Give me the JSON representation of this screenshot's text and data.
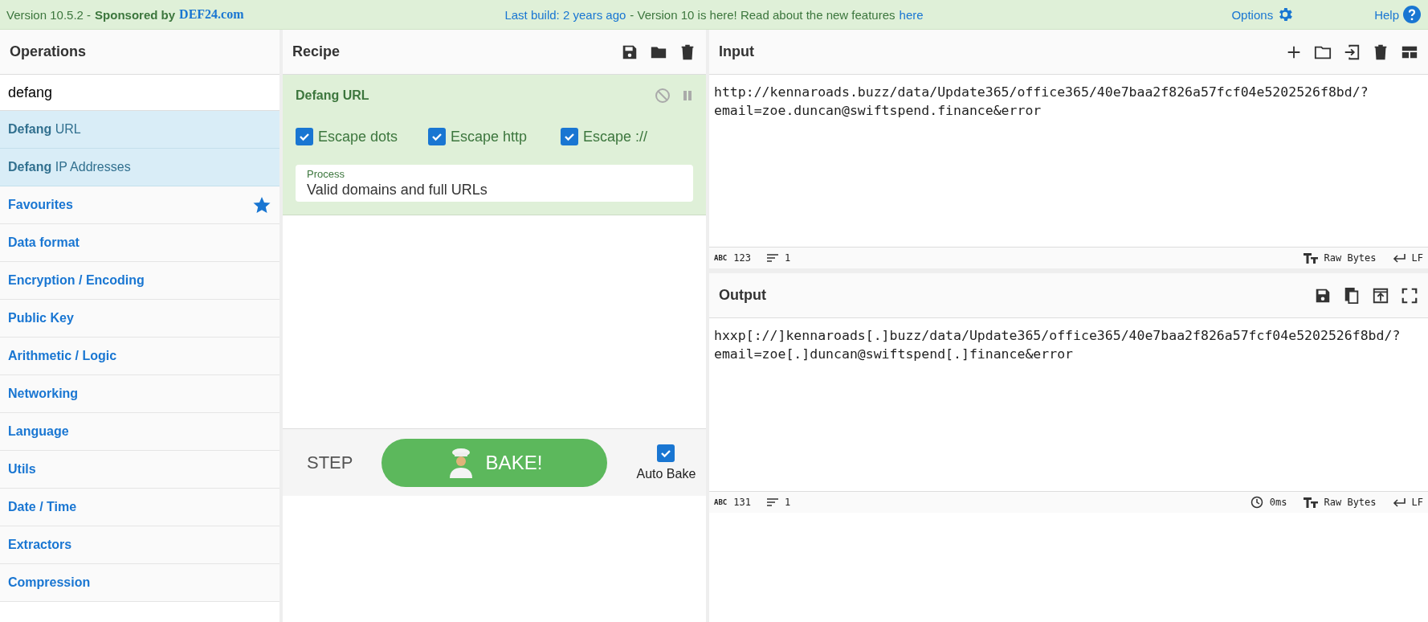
{
  "top_bar": {
    "version": "Version 10.5.2 -",
    "sponsor_label": "Sponsored by",
    "sponsor": "DEF24.com",
    "build": "Last build: 2 years ago",
    "notice": "- Version 10 is here! Read about the new features",
    "notice_link": "here",
    "options": "Options",
    "help": "Help"
  },
  "operations": {
    "title": "Operations",
    "search": {
      "value": "defang"
    },
    "results": [
      {
        "label": "**Defang** URL"
      },
      {
        "label": "**Defang** IP Addresses"
      }
    ],
    "categories": [
      {
        "label": "Favourites",
        "kind": "favourites"
      },
      {
        "label": "Data format",
        "kind": "category"
      },
      {
        "label": "Encryption / Encoding",
        "kind": "category"
      },
      {
        "label": "Public Key",
        "kind": "category"
      },
      {
        "label": "Arithmetic / Logic",
        "kind": "category"
      },
      {
        "label": "Networking",
        "kind": "category"
      },
      {
        "label": "Language",
        "kind": "category"
      },
      {
        "label": "Utils",
        "kind": "category"
      },
      {
        "label": "Date / Time",
        "kind": "category"
      },
      {
        "label": "Extractors",
        "kind": "category"
      },
      {
        "label": "Compression",
        "kind": "category"
      }
    ]
  },
  "recipe": {
    "title": "Recipe",
    "operations": [
      {
        "name": "Defang URL",
        "options": [
          {
            "label": "Escape dots",
            "checked": true
          },
          {
            "label": "Escape http",
            "checked": true
          },
          {
            "label": "Escape ://",
            "checked": true
          }
        ],
        "process": {
          "label": "Process",
          "value": "Valid domains and full URLs"
        }
      }
    ],
    "controls": {
      "step": "STEP",
      "bake": "BAKE!",
      "auto_bake": {
        "label": "Auto Bake",
        "checked": true
      }
    }
  },
  "input": {
    "title": "Input",
    "text_lines": [
      "http://kennaroads.buzz/data/Update365/office365/40e7baa2f826a57fcf04e5202526f8bd/?",
      "email=zoe.duncan@swiftspend.finance&error"
    ],
    "status": {
      "abc": "ABC",
      "length": "123",
      "lines": "1",
      "encoding": "Raw Bytes",
      "eol": "LF"
    }
  },
  "output": {
    "title": "Output",
    "text_lines": [
      "hxxp[://]kennaroads[.]buzz/data/Update365/office365/40e7baa2f826a57fcf04e5202526f8bd/?",
      "email=zoe[.]duncan@swiftspend[.]finance&error"
    ],
    "status": {
      "abc": "ABC",
      "length": "131",
      "lines": "1",
      "time": "0ms",
      "encoding": "Raw Bytes",
      "eol": "LF"
    }
  }
}
